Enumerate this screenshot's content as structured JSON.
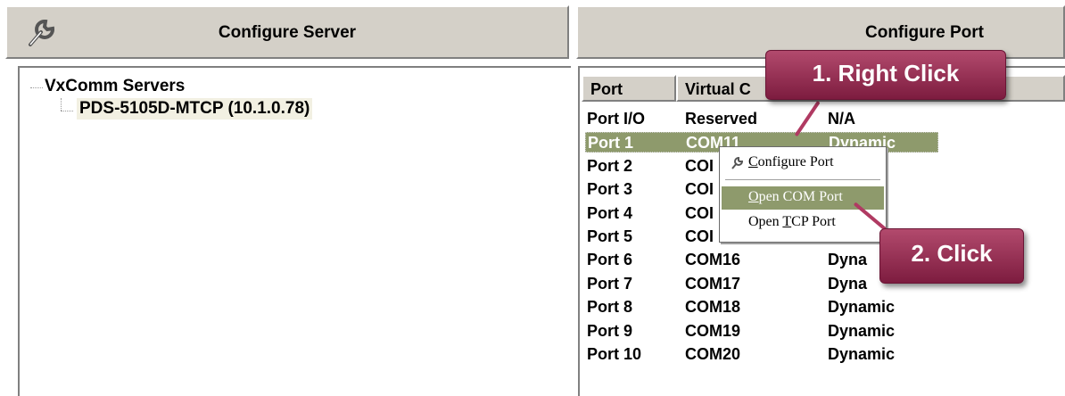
{
  "left_panel": {
    "header_title": "Configure Server",
    "header_icon": "wrench-icon",
    "tree": {
      "root_label": "VxComm Servers",
      "child_label": "PDS-5105D-MTCP (10.1.0.78)"
    }
  },
  "right_panel": {
    "header_title": "Configure Port",
    "columns": [
      "Port",
      "Virtual C"
    ],
    "rows": [
      {
        "port": "Port I/O",
        "virtual_com": "Reserved",
        "type": "N/A"
      },
      {
        "port": "Port 1",
        "virtual_com": "COM11",
        "type": "Dynamic"
      },
      {
        "port": "Port 2",
        "virtual_com": "COI",
        "type": "ic"
      },
      {
        "port": "Port 3",
        "virtual_com": "COI",
        "type": "ic"
      },
      {
        "port": "Port 4",
        "virtual_com": "COI",
        "type": "ic"
      },
      {
        "port": "Port 5",
        "virtual_com": "COI",
        "type": ""
      },
      {
        "port": "Port 6",
        "virtual_com": "COM16",
        "type": "Dyna"
      },
      {
        "port": "Port 7",
        "virtual_com": "COM17",
        "type": "Dyna"
      },
      {
        "port": "Port 8",
        "virtual_com": "COM18",
        "type": "Dynamic"
      },
      {
        "port": "Port 9",
        "virtual_com": "COM19",
        "type": "Dynamic"
      },
      {
        "port": "Port 10",
        "virtual_com": "COM20",
        "type": "Dynamic"
      }
    ],
    "selected_row_index": 1
  },
  "context_menu": {
    "items": [
      {
        "label": "Configure Port",
        "icon": "configure-port-icon"
      },
      {
        "label": "Open COM Port"
      },
      {
        "label": "Open TCP Port"
      }
    ],
    "highlighted_index": 1
  },
  "callouts": {
    "step1": "1. Right Click",
    "step2": "2. Click"
  },
  "colors": {
    "selection": "#8e9a6c",
    "callout": "#9b2d52",
    "window_face": "#d4d0c8"
  }
}
